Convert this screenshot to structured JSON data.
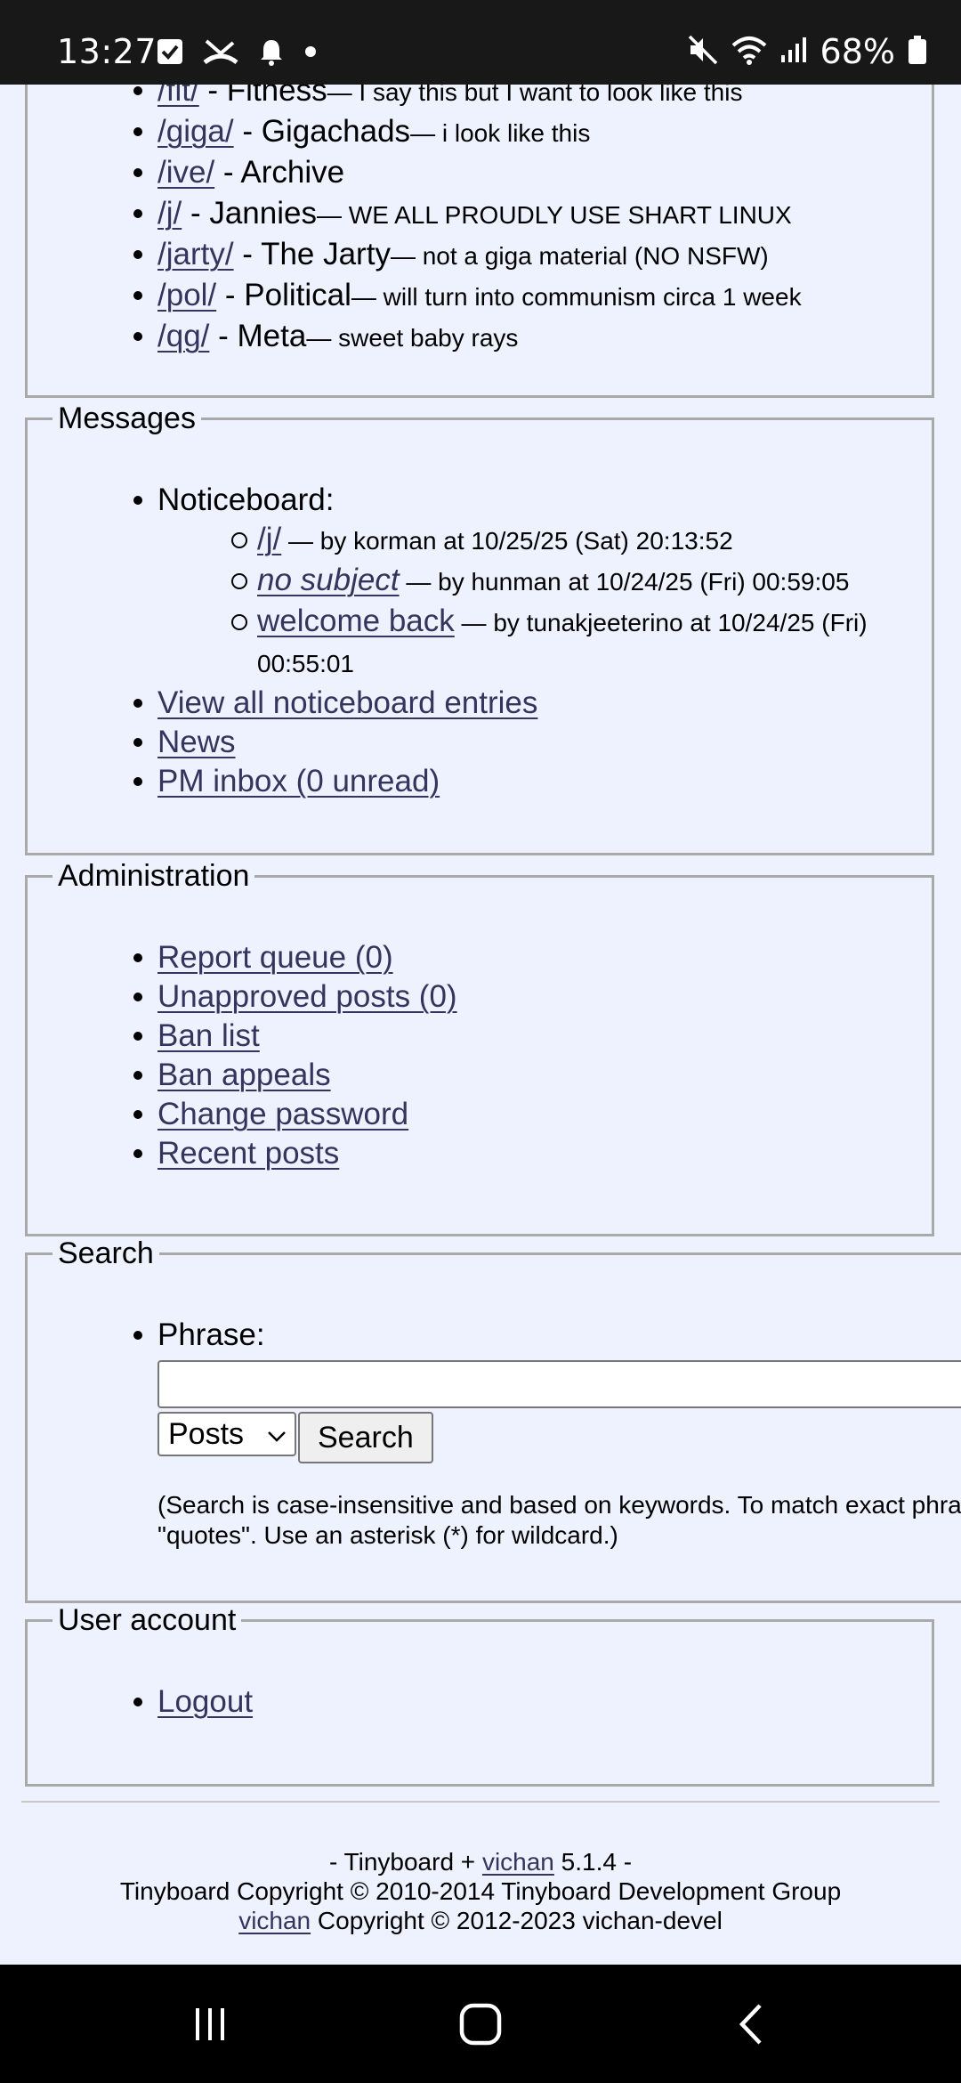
{
  "status_bar": {
    "time": "13:27",
    "battery": "68%",
    "icons": [
      "checkbox-icon",
      "missed-call-icon",
      "bell-icon",
      "dot-icon",
      "mute-icon",
      "wifi-icon",
      "signal-icon",
      "battery-icon"
    ]
  },
  "boards": [
    {
      "link": "/fit/",
      "sep": " - ",
      "name": "Fitness",
      "desc": "— I say this but I want to look like this"
    },
    {
      "link": "/giga/",
      "sep": " - ",
      "name": "Gigachads",
      "desc": "— i look like this"
    },
    {
      "link": "/ive/",
      "sep": " - ",
      "name": "Archive",
      "desc": ""
    },
    {
      "link": "/j/",
      "sep": " - ",
      "name": "Jannies",
      "desc": "— WE ALL PROUDLY USE SHART LINUX"
    },
    {
      "link": "/jarty/",
      "sep": " - ",
      "name": "The Jarty",
      "desc": "— not a giga material (NO NSFW)"
    },
    {
      "link": "/pol/",
      "sep": " - ",
      "name": "Political",
      "desc": "— will turn into communism circa 1 week"
    },
    {
      "link": "/qg/",
      "sep": " - ",
      "name": "Meta",
      "desc": "— sweet baby rays"
    }
  ],
  "messages": {
    "legend": "Messages",
    "noticeboard_label": "Noticeboard:",
    "entries": [
      {
        "subject": "/j/",
        "meta": " — by korman at 10/25/25 (Sat) 20:13:52"
      },
      {
        "subject": "no subject",
        "meta": " — by hunman at 10/24/25 (Fri) 00:59:05"
      },
      {
        "subject": "welcome back",
        "meta": " — by tunakjeeterino at 10/24/25 (Fri) 00:55:01"
      }
    ],
    "view_all": "View all noticeboard entries",
    "news": "News",
    "pm_inbox": "PM inbox (0 unread)"
  },
  "administration": {
    "legend": "Administration",
    "items": [
      "Report queue (0)",
      "Unapproved posts (0)",
      "Ban list",
      "Ban appeals",
      "Change password",
      "Recent posts"
    ]
  },
  "search": {
    "legend": "Search",
    "phrase_label": "Phrase:",
    "phrase_value": "",
    "type_selected": "Posts",
    "button_label": "Search",
    "note": "(Search is case-insensitive and based on keywords. To match exact phrase, use \"quotes\". Use an asterisk (*) for wildcard.)"
  },
  "user_account": {
    "legend": "User account",
    "logout": "Logout"
  },
  "footer": {
    "line1_pre": "- Tinyboard + ",
    "line1_link": "vichan",
    "line1_post": " 5.1.4 -",
    "line2": "Tinyboard Copyright © 2010-2014 Tinyboard Development Group",
    "line3_link": "vichan",
    "line3_post": " Copyright © 2012-2023 vichan-devel"
  },
  "nav_bar": {
    "icons": [
      "recent-apps-icon",
      "home-icon",
      "back-icon"
    ]
  }
}
